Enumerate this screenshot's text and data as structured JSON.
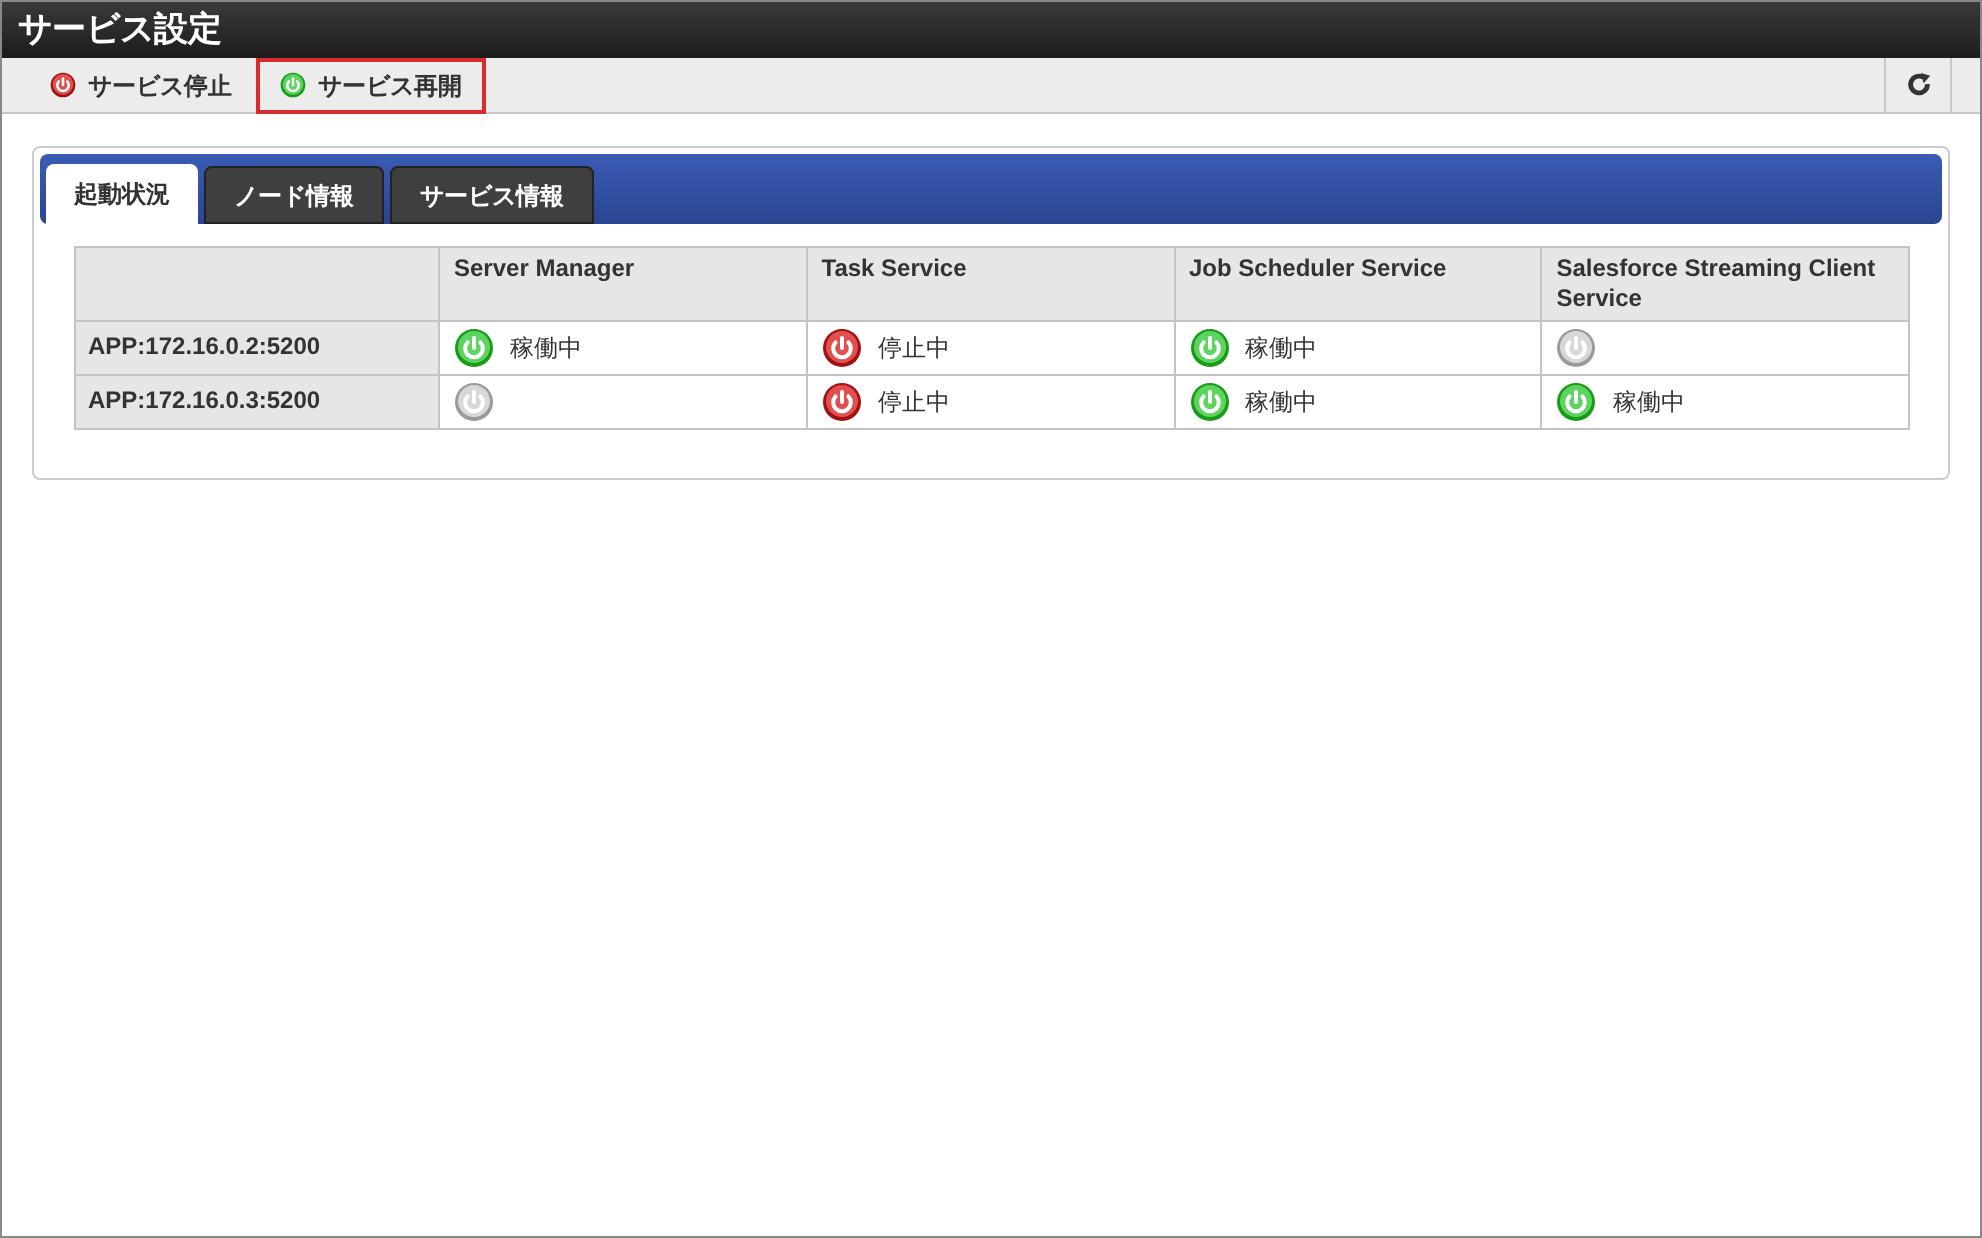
{
  "window": {
    "title": "サービス設定"
  },
  "toolbar": {
    "buttons": [
      {
        "label": "サービス停止",
        "kind": "stop",
        "highlighted": false
      },
      {
        "label": "サービス再開",
        "kind": "start",
        "highlighted": true
      }
    ]
  },
  "tabs": [
    {
      "label": "起動状況",
      "selected": true
    },
    {
      "label": "ノード情報",
      "selected": false
    },
    {
      "label": "サービス情報",
      "selected": false
    }
  ],
  "table": {
    "columns": [
      "Server Manager",
      "Task Service",
      "Job Scheduler Service",
      "Salesforce Streaming Client Service"
    ],
    "rows": [
      {
        "node": "APP:172.16.0.2:5200",
        "cells": [
          {
            "kind": "running",
            "text": "稼働中"
          },
          {
            "kind": "stopped",
            "text": "停止中"
          },
          {
            "kind": "running",
            "text": "稼働中"
          },
          {
            "kind": "none"
          }
        ]
      },
      {
        "node": "APP:172.16.0.3:5200",
        "cells": [
          {
            "kind": "none"
          },
          {
            "kind": "stopped",
            "text": "停止中"
          },
          {
            "kind": "running",
            "text": "稼働中"
          },
          {
            "kind": "running",
            "text": "稼働中"
          }
        ]
      }
    ]
  }
}
